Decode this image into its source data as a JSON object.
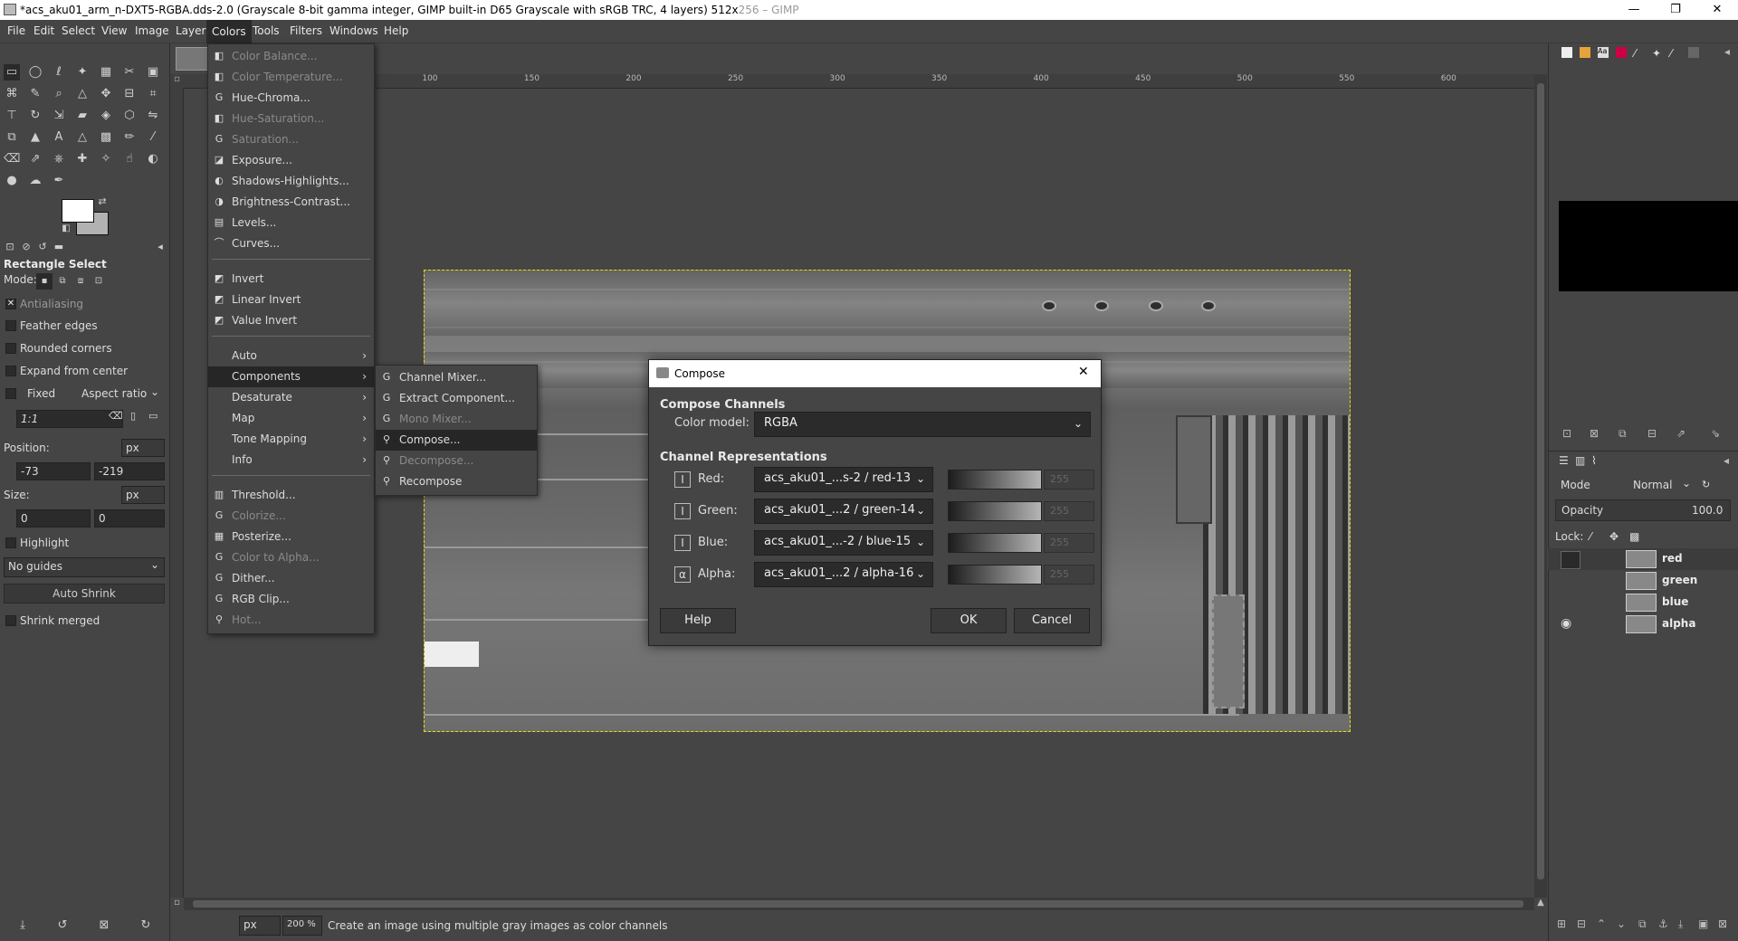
{
  "window": {
    "title": "*acs_aku01_arm_n-DXT5-RGBA.dds-2.0 (Grayscale 8-bit gamma integer, GIMP built-in D65 Grayscale with sRGB TRC, 4 layers) 512x",
    "title_dim": "256 – GIMP",
    "minimize": "—",
    "maximize": "❐",
    "close": "✕"
  },
  "menubar": [
    "File",
    "Edit",
    "Select",
    "View",
    "Image",
    "Layer",
    "Colors",
    "Tools",
    "Filters",
    "Windows",
    "Help"
  ],
  "tool_options": {
    "title": "Rectangle Select",
    "mode_label": "Mode:",
    "antialiasing": "Antialiasing",
    "feather": "Feather edges",
    "rounded": "Rounded corners",
    "expand": "Expand from center",
    "fixed": "Fixed",
    "aspect": "Aspect ratio",
    "ratio_value": "1:1",
    "position_label": "Position:",
    "unit": "px",
    "pos_x": "-73",
    "pos_y": "-219",
    "size_label": "Size:",
    "size_w": "0",
    "size_h": "0",
    "highlight": "Highlight",
    "guides": "No guides",
    "auto_shrink": "Auto Shrink",
    "shrink_merged": "Shrink merged"
  },
  "ruler_ticks": [
    "0",
    "100",
    "150",
    "200",
    "250",
    "300",
    "350",
    "400",
    "450",
    "500",
    "550",
    "600"
  ],
  "colors_menu": [
    {
      "label": "Color Balance...",
      "disabled": true
    },
    {
      "label": "Color Temperature...",
      "disabled": true
    },
    {
      "label": "Hue-Chroma...",
      "disabled": false
    },
    {
      "label": "Hue-Saturation...",
      "disabled": true
    },
    {
      "label": "Saturation...",
      "disabled": true
    },
    {
      "label": "Exposure...",
      "disabled": false
    },
    {
      "label": "Shadows-Highlights...",
      "disabled": false
    },
    {
      "label": "Brightness-Contrast...",
      "disabled": false
    },
    {
      "label": "Levels...",
      "disabled": false
    },
    {
      "label": "Curves...",
      "disabled": false
    },
    {
      "label": "Invert",
      "disabled": false
    },
    {
      "label": "Linear Invert",
      "disabled": false
    },
    {
      "label": "Value Invert",
      "disabled": false
    },
    {
      "label": "Auto",
      "disabled": false
    },
    {
      "label": "Components",
      "disabled": false
    },
    {
      "label": "Desaturate",
      "disabled": false
    },
    {
      "label": "Map",
      "disabled": false
    },
    {
      "label": "Tone Mapping",
      "disabled": false
    },
    {
      "label": "Info",
      "disabled": false
    },
    {
      "label": "Threshold...",
      "disabled": false
    },
    {
      "label": "Colorize...",
      "disabled": true
    },
    {
      "label": "Posterize...",
      "disabled": false
    },
    {
      "label": "Color to Alpha...",
      "disabled": true
    },
    {
      "label": "Dither...",
      "disabled": false
    },
    {
      "label": "RGB Clip...",
      "disabled": false
    },
    {
      "label": "Hot...",
      "disabled": true
    }
  ],
  "components_menu": [
    {
      "label": "Channel Mixer...",
      "disabled": false
    },
    {
      "label": "Extract Component...",
      "disabled": false
    },
    {
      "label": "Mono Mixer...",
      "disabled": true
    },
    {
      "label": "Compose...",
      "disabled": false
    },
    {
      "label": "Decompose...",
      "disabled": true
    },
    {
      "label": "Recompose",
      "disabled": false
    }
  ],
  "dialog": {
    "title": "Compose",
    "close": "✕",
    "section1": "Compose Channels",
    "color_model_label": "Color model:",
    "color_model": "RGBA",
    "section2": "Channel Representations",
    "channels": [
      {
        "label": "Red:",
        "icon": "I",
        "value": "acs_aku01_...s-2 / red-13",
        "spin": "255"
      },
      {
        "label": "Green:",
        "icon": "I",
        "value": "acs_aku01_...2 / green-14",
        "spin": "255"
      },
      {
        "label": "Blue:",
        "icon": "I",
        "value": "acs_aku01_...-2 / blue-15",
        "spin": "255"
      },
      {
        "label": "Alpha:",
        "icon": "α",
        "value": "acs_aku01_...2 / alpha-16",
        "spin": "255"
      }
    ],
    "help": "Help",
    "ok": "OK",
    "cancel": "Cancel"
  },
  "layers": {
    "mode_label": "Mode",
    "mode_value": "Normal",
    "opacity_label": "Opacity",
    "opacity_value": "100.0",
    "lock_label": "Lock:",
    "items": [
      "red",
      "green",
      "blue",
      "alpha"
    ]
  },
  "statusbar": {
    "unit": "px",
    "zoom": "200 %",
    "message": "Create an image using multiple gray images as color channels"
  }
}
